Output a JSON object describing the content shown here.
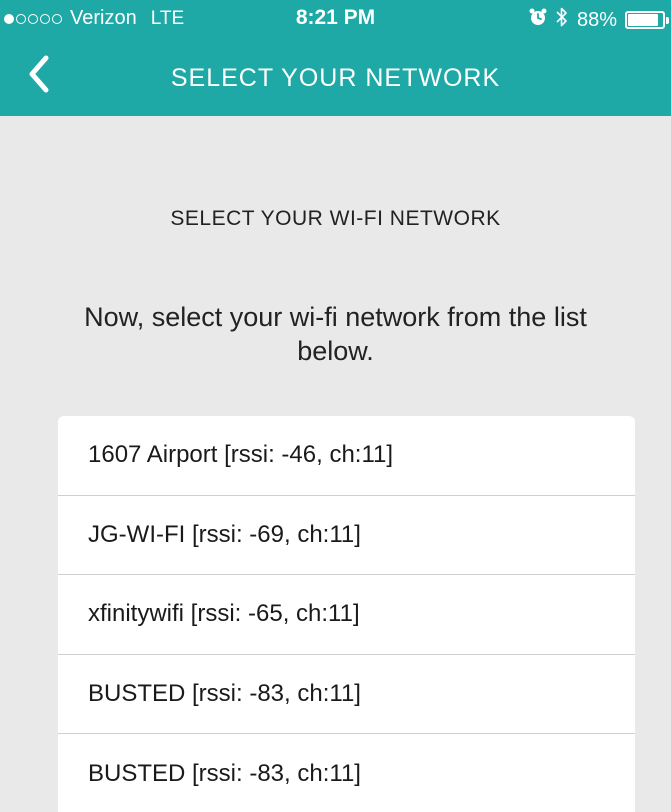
{
  "status_bar": {
    "carrier": "Verizon",
    "network_type": "LTE",
    "time": "8:21 PM",
    "battery_percent": "88%",
    "battery_level": 0.88,
    "signal_bars_filled": 1,
    "signal_bars_total": 5,
    "icons": [
      "alarm-icon",
      "bluetooth-icon",
      "battery-icon"
    ]
  },
  "nav": {
    "title": "SELECT YOUR NETWORK",
    "back_icon": "chevron-left-icon"
  },
  "content": {
    "heading": "SELECT YOUR WI-FI NETWORK",
    "instruction": "Now, select your wi-fi network from the list below."
  },
  "networks": [
    {
      "label": "1607 Airport [rssi: -46, ch:11]"
    },
    {
      "label": "JG-WI-FI [rssi: -69, ch:11]"
    },
    {
      "label": "xfinitywifi [rssi: -65, ch:11]"
    },
    {
      "label": "BUSTED [rssi: -83, ch:11]"
    },
    {
      "label": "BUSTED [rssi: -83, ch:11]"
    }
  ],
  "colors": {
    "accent": "#1fa9a6",
    "background": "#e9e9e9",
    "card": "#ffffff",
    "text": "#222222"
  }
}
